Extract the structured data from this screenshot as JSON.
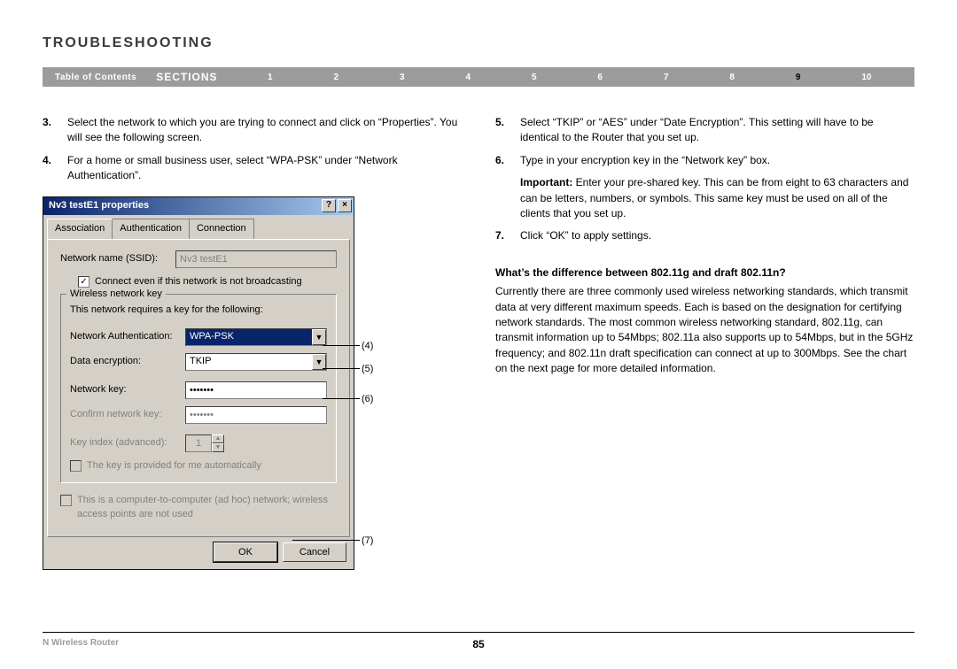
{
  "header": {
    "title": "Troubleshooting"
  },
  "nav": {
    "toc": "Table of Contents",
    "sections_label": "SECTIONS",
    "items": [
      "1",
      "2",
      "3",
      "4",
      "5",
      "6",
      "7",
      "8",
      "9",
      "10"
    ],
    "active_index": 8
  },
  "left_steps": [
    {
      "num": "3.",
      "text": "Select the network to which you are trying to connect and click on “Properties”. You will see the following screen."
    },
    {
      "num": "4.",
      "text": "For a home or small business user, select “WPA-PSK” under “Network Authentication”."
    }
  ],
  "right_steps_a": [
    {
      "num": "5.",
      "text": "Select “TKIP” or “AES” under “Date Encryption”. This setting will have to be identical to the Router that you set up."
    },
    {
      "num": "6.",
      "text": "Type in your encryption key in the “Network key” box."
    }
  ],
  "important": {
    "label": "Important:",
    "text": " Enter your pre-shared key. This can be from eight to 63 characters and can be letters, numbers, or symbols. This same key must be used on all of the clients that you set up."
  },
  "right_steps_b": [
    {
      "num": "7.",
      "text": "Click “OK” to apply settings."
    }
  ],
  "subheading": "What’s the difference between 802.11g and draft 802.11n?",
  "body_para": "Currently there are three commonly used wireless networking standards, which transmit data at very different maximum speeds. Each is based on the designation for certifying network standards. The most common wireless networking standard, 802.11g, can transmit information up to 54Mbps; 802.11a also supports up to 54Mbps, but in the 5GHz frequency; and 802.11n draft specification can connect at up to 300Mbps. See the chart on the next page for more detailed information.",
  "dialog": {
    "title": "Nv3 testE1 properties",
    "tabs": [
      "Association",
      "Authentication",
      "Connection"
    ],
    "active_tab": 0,
    "ssid_label": "Network name (SSID):",
    "ssid_value": "Nv3 testE1",
    "broadcast_cb": "Connect even if this network is not broadcasting",
    "broadcast_checked": true,
    "group_legend": "Wireless network key",
    "group_desc": "This network requires a key for the following:",
    "auth_label": "Network Authentication:",
    "auth_value": "WPA-PSK",
    "enc_label": "Data encryption:",
    "enc_value": "TKIP",
    "key_label": "Network key:",
    "key_value": "•••••••",
    "confirm_label": "Confirm network key:",
    "confirm_value": "•••••••",
    "keyindex_label": "Key index (advanced):",
    "keyindex_value": "1",
    "auto_cb": "The key is provided for me automatically",
    "adhoc_cb": "This is a computer-to-computer (ad hoc) network; wireless access points are not used",
    "ok": "OK",
    "cancel": "Cancel"
  },
  "callouts": {
    "c4": "(4)",
    "c5": "(5)",
    "c6": "(6)",
    "c7": "(7)"
  },
  "footer": {
    "product": "N Wireless Router",
    "page": "85"
  }
}
